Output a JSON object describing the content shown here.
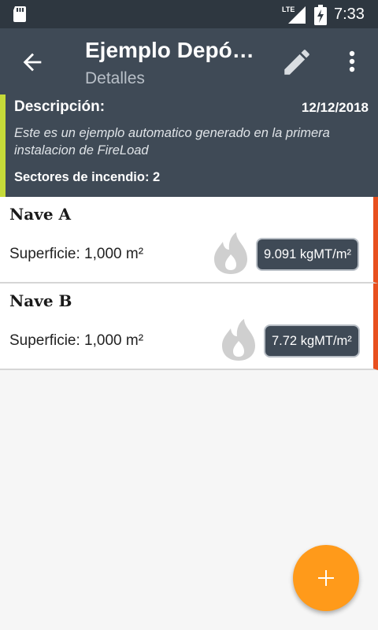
{
  "status_bar": {
    "network": "LTE",
    "time": "7:33",
    "icons": [
      "sd-card-icon",
      "lte-signal-icon",
      "battery-charging-icon"
    ]
  },
  "toolbar": {
    "title": "Ejemplo Depó…",
    "subtitle": "Detalles",
    "icons": [
      "back-arrow-icon",
      "edit-pencil-icon",
      "more-vert-icon"
    ],
    "color": "#3f4a56"
  },
  "description": {
    "label": "Descripción:",
    "date": "12/12/2018",
    "text": "Este es un  ejemplo automatico generado en la primera instalacion de FireLoad",
    "sectors_label": "Sectores de incendio: 2",
    "accent_color": "#c6db39"
  },
  "sectors": [
    {
      "name": "Nave A",
      "area": "Superficie: 1,000 m²",
      "load": "9.091 kgMT/m²",
      "icon": "flame-icon"
    },
    {
      "name": "Nave B",
      "area": "Superficie: 1,000 m²",
      "load": "7.72 kgMT/m²",
      "icon": "flame-icon"
    }
  ],
  "sector_accent_color": "#e8501f",
  "fab": {
    "icon": "add-icon",
    "color": "#ff9a1a"
  }
}
